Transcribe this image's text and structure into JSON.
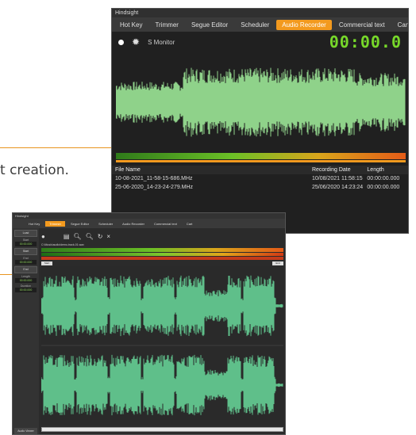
{
  "caption": "t creation.",
  "recorder": {
    "window_title": "Hindsight",
    "tabs": [
      "Hot Key",
      "Trimmer",
      "Segue Editor",
      "Scheduler",
      "Audio Recorder",
      "Commercial text",
      "Cart"
    ],
    "active_tab": "Audio Recorder",
    "monitor_label": "S Monitor",
    "timer": "00:00.0",
    "file_table": {
      "columns": [
        "File Name",
        "Recording Date",
        "Length"
      ],
      "rows": [
        [
          "10-08-2021_11-58-15-686.MHz",
          "10/08/2021 11:58:15",
          "00:00:00.000"
        ],
        [
          "25-06-2020_14-23-24-279.MHz",
          "25/06/2020 14:23:24",
          "00:00:00.000"
        ]
      ]
    },
    "colors": {
      "accent": "#f39a1e",
      "timer": "#77d82a",
      "waveform": "#8fd28a",
      "background": "#202020"
    }
  },
  "trimmer": {
    "window_title": "Hindsight",
    "tabs": [
      "Hot Key",
      "Trimmer",
      "Segue Editor",
      "Scheduler",
      "Audio Recorder",
      "Commercial text",
      "Cart"
    ],
    "active_tab": "Trimmer",
    "side_buttons": [
      "Load",
      "Start",
      "End"
    ],
    "side_fields": [
      {
        "label": "Start",
        "value": "00:00.000"
      },
      {
        "label": "End",
        "value": "00:00.000"
      },
      {
        "label": "Length",
        "value": "00:00.000"
      },
      {
        "label": "Duration",
        "value": "00:00.000"
      }
    ],
    "save_label": "Save",
    "bottom_button": "Audio Viewer",
    "info_text": "C:\\Music\\audio\\demo-track-01.wav",
    "start_mark": "Start",
    "end_mark": "End",
    "colors": {
      "accent": "#f39a1e",
      "waveform": "#5fbf8a"
    }
  }
}
